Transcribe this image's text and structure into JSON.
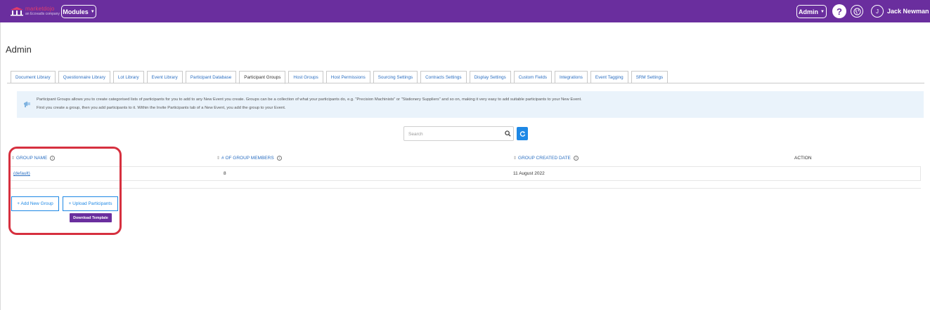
{
  "topbar": {
    "logo": {
      "brand_text": "marketdojo",
      "tagline": "an Ecovadis company"
    },
    "modules_label": "Modules",
    "admin_label": "Admin",
    "help_symbol": "?",
    "avatar_initial": "J",
    "user_name": "Jack Newman",
    "icons": {
      "logo": "logo-icon",
      "globe": "globe-icon",
      "caret": "caret-down-icon"
    }
  },
  "page": {
    "title": "Admin"
  },
  "tabs": [
    {
      "label": "Document Library",
      "active": false
    },
    {
      "label": "Questionnaire Library",
      "active": false
    },
    {
      "label": "Lot Library",
      "active": false
    },
    {
      "label": "Event Library",
      "active": false
    },
    {
      "label": "Participant Database",
      "active": false
    },
    {
      "label": "Participant Groups",
      "active": true
    },
    {
      "label": "Host Groups",
      "active": false
    },
    {
      "label": "Host Permissions",
      "active": false
    },
    {
      "label": "Sourcing Settings",
      "active": false
    },
    {
      "label": "Contracts Settings",
      "active": false
    },
    {
      "label": "Display Settings",
      "active": false
    },
    {
      "label": "Custom Fields",
      "active": false
    },
    {
      "label": "Integrations",
      "active": false
    },
    {
      "label": "Event Tagging",
      "active": false
    },
    {
      "label": "SRM Settings",
      "active": false
    }
  ],
  "info": {
    "line1": "Participant Groups allows you to create categorised lists of participants for you to add to any New Event you create. Groups can be a collection of what your participants do, e.g. \"Precision Machinists\" or \"Stationery Suppliers\" and so on, making it very easy to add suitable participants to your New Event.",
    "line2": "First you create a group, then you add participants to it. Within the Invite Participants tab of a New Event, you add the group to your Event."
  },
  "search": {
    "placeholder": "Search",
    "value": ""
  },
  "table": {
    "columns": {
      "group_name": "GROUP NAME",
      "members": "# OF GROUP MEMBERS",
      "created": "GROUP CREATED DATE",
      "action": "ACTION"
    },
    "rows": [
      {
        "group_name": "(default)",
        "members": "8",
        "created": "11 August 2022",
        "action": ""
      }
    ]
  },
  "buttons": {
    "add_new_group": "+ Add New Group",
    "upload_participants": "+ Upload Participants",
    "download_template": "Download Template"
  },
  "colors": {
    "topbar": "#6a2e9e",
    "accent": "#1e88e5",
    "link": "#2b6fc2",
    "highlight": "#d6303f",
    "info_bg": "#eaf3fb"
  }
}
